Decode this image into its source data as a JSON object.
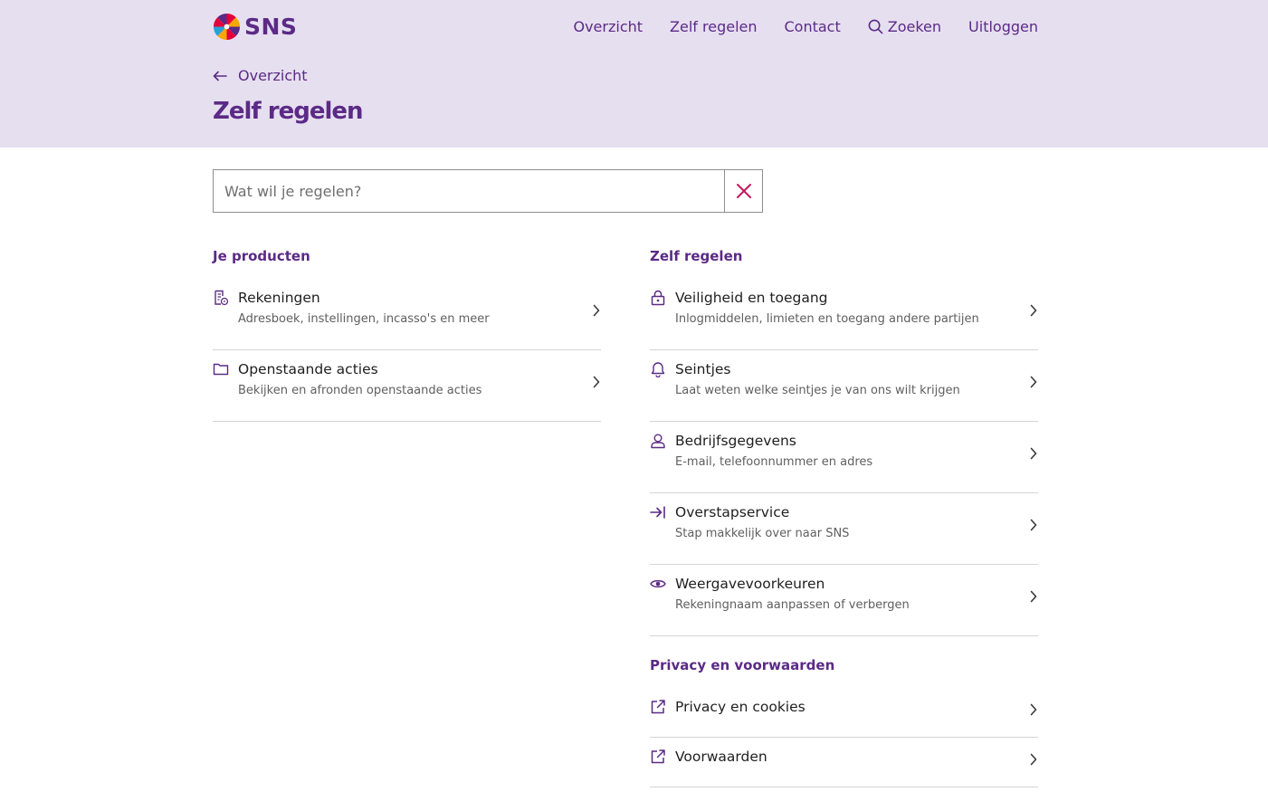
{
  "brand": {
    "name": "SNS",
    "accent": "#5b2a86",
    "close_color": "#c2185b"
  },
  "nav": {
    "overview": "Overzicht",
    "self_service": "Zelf regelen",
    "contact": "Contact",
    "search": "Zoeken",
    "logout": "Uitloggen"
  },
  "header": {
    "back_label": "Overzicht",
    "title": "Zelf regelen"
  },
  "search": {
    "placeholder": "Wat wil je regelen?",
    "value": ""
  },
  "products": {
    "title": "Je producten",
    "items": [
      {
        "title": "Rekeningen",
        "subtitle": "Adresboek, instellingen, incasso's en meer",
        "icon": "accounts-document-icon"
      },
      {
        "title": "Openstaande acties",
        "subtitle": "Bekijken en afronden openstaande acties",
        "icon": "folder-icon"
      }
    ]
  },
  "self_service": {
    "title": "Zelf regelen",
    "items": [
      {
        "title": "Veiligheid en toegang",
        "subtitle": "Inlogmiddelen, limieten en toegang andere partijen",
        "icon": "lock-icon"
      },
      {
        "title": "Seintjes",
        "subtitle": "Laat weten welke seintjes je van ons wilt krijgen",
        "icon": "bell-icon"
      },
      {
        "title": "Bedrijfsgegevens",
        "subtitle": "E-mail, telefoonnummer en adres",
        "icon": "user-icon"
      },
      {
        "title": "Overstapservice",
        "subtitle": "Stap makkelijk over naar SNS",
        "icon": "switch-arrow-icon"
      },
      {
        "title": "Weergavevoorkeuren",
        "subtitle": "Rekeningnaam aanpassen of verbergen",
        "icon": "eye-icon"
      }
    ]
  },
  "privacy": {
    "title": "Privacy en voorwaarden",
    "items": [
      {
        "title": "Privacy en cookies",
        "icon": "external-link-icon"
      },
      {
        "title": "Voorwaarden",
        "icon": "external-link-icon"
      }
    ]
  }
}
